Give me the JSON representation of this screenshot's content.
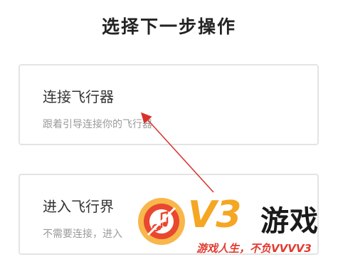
{
  "page_title": "选择下一步操作",
  "options": [
    {
      "title": "连接飞行器",
      "description": "跟着引导连接你的飞行器"
    },
    {
      "title": "进入飞行界",
      "description": "不需要连接，进入"
    }
  ],
  "watermark": {
    "brand": "V3",
    "brand_suffix": "游戏",
    "slogan": "游戏人生，不负VVVV3",
    "logo_icon": "music-note-disc-icon"
  },
  "colors": {
    "arrow": "#d9322b",
    "brand_orange": "#f5a623",
    "slogan_red": "#e23a2e",
    "card_border": "#e4e4e4"
  }
}
